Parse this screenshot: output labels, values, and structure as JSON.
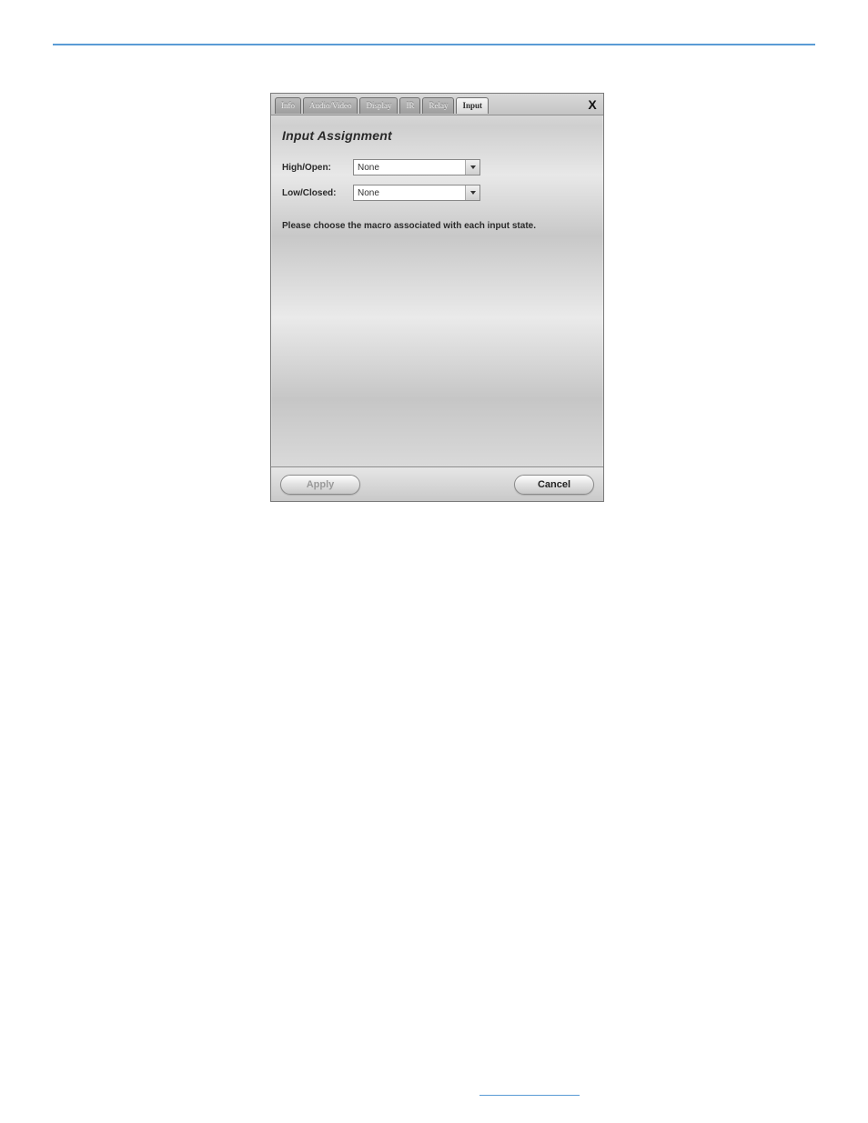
{
  "tabs": [
    "Info",
    "Audio/Video",
    "Display",
    "IR",
    "Relay",
    "Input"
  ],
  "active_tab": "Input",
  "close_label": "X",
  "heading": "Input Assignment",
  "fields": {
    "high_open": {
      "label": "High/Open:",
      "value": "None"
    },
    "low_closed": {
      "label": "Low/Closed:",
      "value": "None"
    }
  },
  "instruction": "Please choose the macro associated with each input state.",
  "buttons": {
    "apply": "Apply",
    "cancel": "Cancel"
  },
  "colors": {
    "rule": "#5a9bd5"
  }
}
